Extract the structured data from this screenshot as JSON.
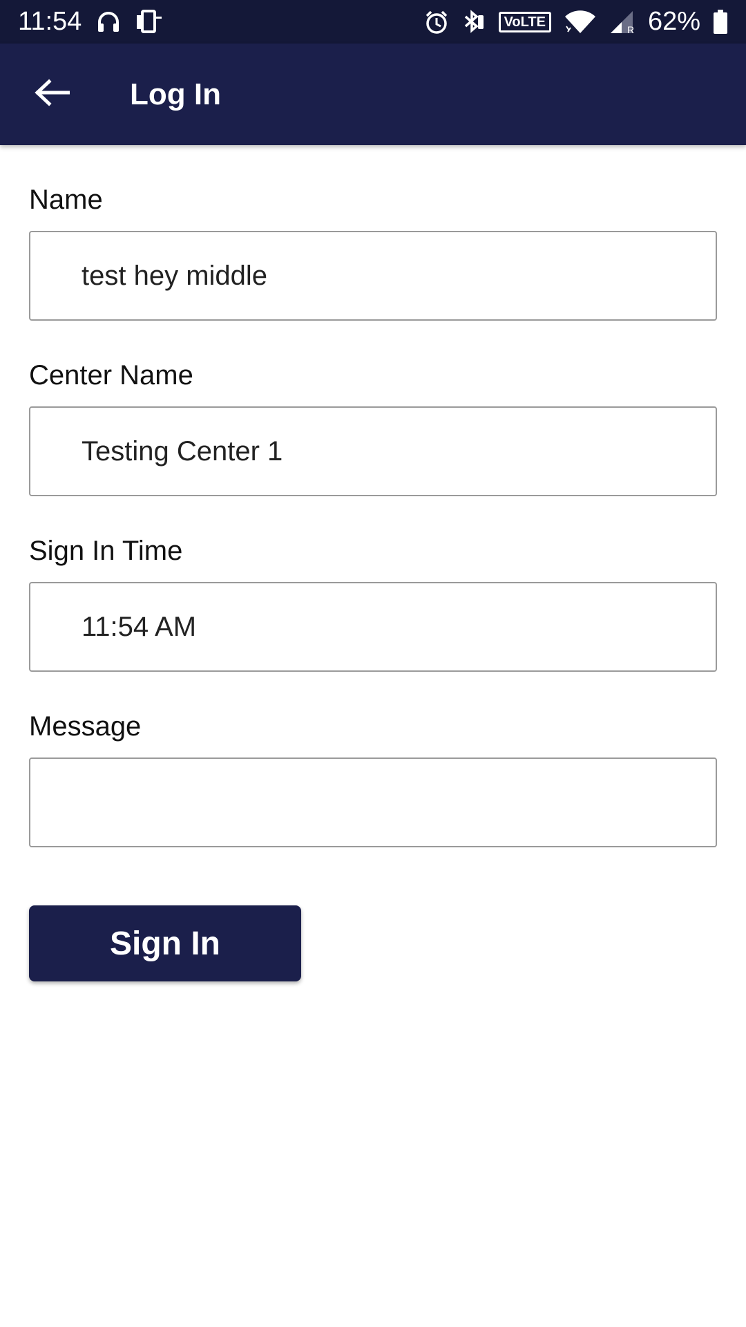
{
  "status_bar": {
    "time": "11:54",
    "volte_label": "VoLTE",
    "battery_pct": "62%",
    "icons": [
      "headphones-icon",
      "phone-cast-icon",
      "alarm-icon",
      "bluetooth-icon",
      "volte-icon",
      "wifi-icon",
      "cell-signal-icon",
      "battery-icon"
    ]
  },
  "app_bar": {
    "title": "Log In",
    "back_icon": "arrow-left-icon"
  },
  "form": {
    "name": {
      "label": "Name",
      "value": "test hey middle"
    },
    "center_name": {
      "label": "Center Name",
      "value": "Testing Center 1"
    },
    "sign_in_time": {
      "label": "Sign In Time",
      "value": "11:54 AM"
    },
    "message": {
      "label": "Message",
      "value": ""
    }
  },
  "actions": {
    "sign_in_label": "Sign In"
  },
  "colors": {
    "status_bar_bg": "#141838",
    "app_bar_bg": "#1b1f4b",
    "button_bg": "#1b1f4b",
    "input_border": "#9a9a9a"
  }
}
